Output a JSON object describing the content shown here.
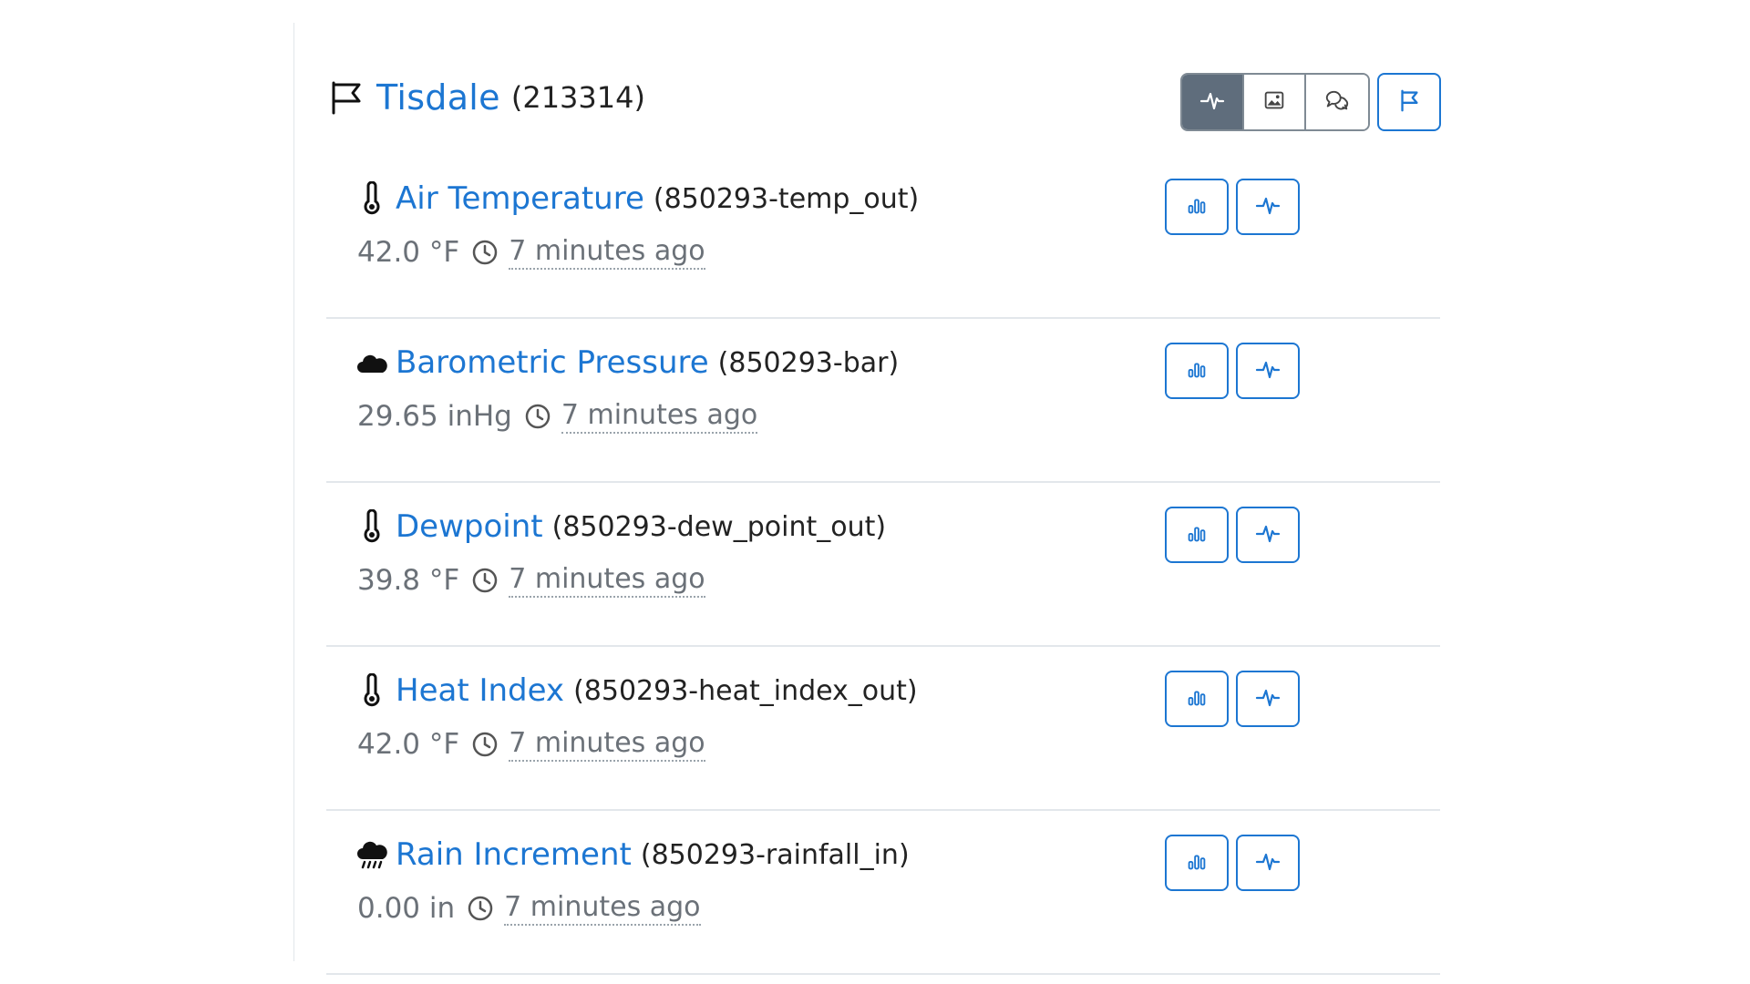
{
  "station": {
    "name": "Tisdale",
    "id": "(213314)"
  },
  "toolbar": {
    "segments": [
      {
        "icon": "pulse-icon",
        "active": true
      },
      {
        "icon": "image-icon",
        "active": false
      },
      {
        "icon": "chat-icon",
        "active": false
      }
    ],
    "flag_icon": "flag-icon"
  },
  "sensors": [
    {
      "icon": "thermometer-icon",
      "name": "Air Temperature",
      "id": "(850293-temp_out)",
      "value": "42.0 °F",
      "time": "7 minutes ago"
    },
    {
      "icon": "cloud-icon",
      "name": "Barometric Pressure",
      "id": "(850293-bar)",
      "value": "29.65 inHg",
      "time": "7 minutes ago"
    },
    {
      "icon": "thermometer-icon",
      "name": "Dewpoint",
      "id": "(850293-dew_point_out)",
      "value": "39.8 °F",
      "time": "7 minutes ago"
    },
    {
      "icon": "thermometer-icon",
      "name": "Heat Index",
      "id": "(850293-heat_index_out)",
      "value": "42.0 °F",
      "time": "7 minutes ago"
    },
    {
      "icon": "rain-cloud-icon",
      "name": "Rain Increment",
      "id": "(850293-rainfall_in)",
      "value": "0.00 in",
      "time": "7 minutes ago"
    }
  ],
  "colors": {
    "link": "#1c76d2",
    "muted": "#6b7178",
    "active_segment": "#5f6d7c"
  }
}
